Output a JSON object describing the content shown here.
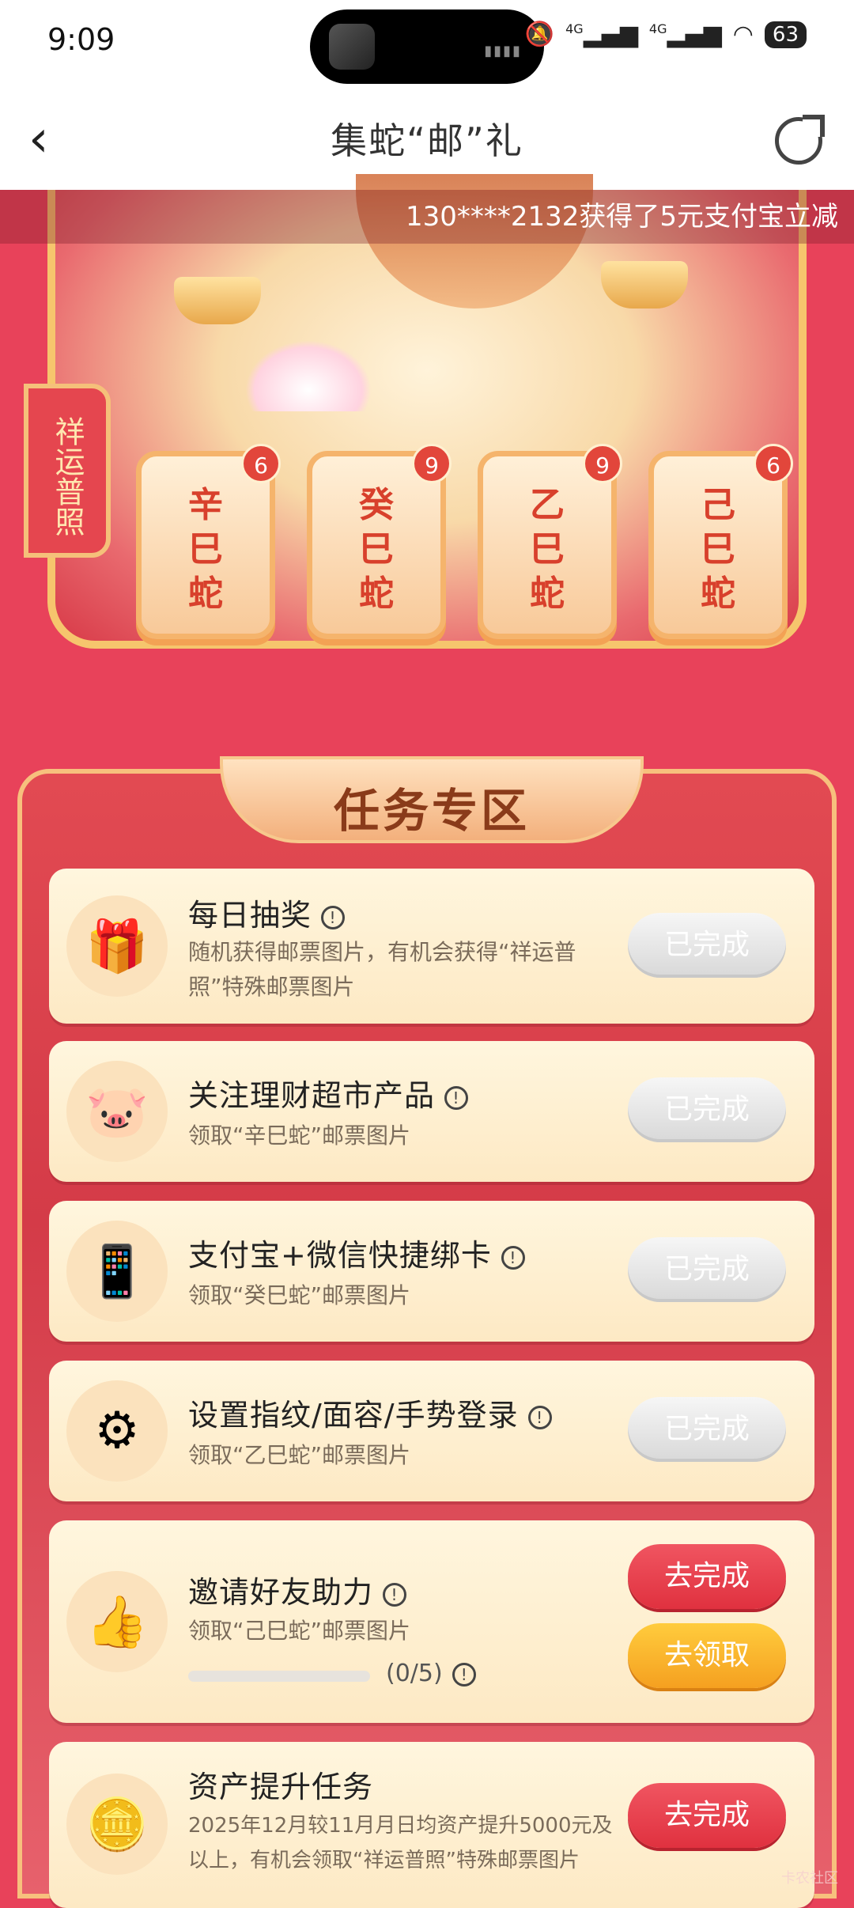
{
  "status_bar": {
    "time": "9:09",
    "signal_1": "4G",
    "signal_2": "4G",
    "battery": "63"
  },
  "nav": {
    "title": "集蛇“邮”礼"
  },
  "ticker": {
    "text": "130****2132获得了5元支付宝立减"
  },
  "stamps": {
    "side_label": "祥运普照",
    "items": [
      {
        "name": "辛巳蛇",
        "line1": "辛",
        "line2": "巳",
        "line3": "蛇",
        "count": "6"
      },
      {
        "name": "癸巳蛇",
        "line1": "癸",
        "line2": "巳",
        "line3": "蛇",
        "count": "9"
      },
      {
        "name": "乙巳蛇",
        "line1": "乙",
        "line2": "巳",
        "line3": "蛇",
        "count": "9"
      },
      {
        "name": "己巳蛇",
        "line1": "己",
        "line2": "巳",
        "line3": "蛇",
        "count": "6"
      }
    ]
  },
  "panel": {
    "title": "任务专区"
  },
  "tasks": [
    {
      "title": "每日抽奖",
      "desc": "随机获得邮票图片，有机会获得“祥运普照”特殊邮票图片",
      "button": "已完成",
      "icon": "gift-icon"
    },
    {
      "title": "关注理财超市产品",
      "desc": "领取“辛巳蛇”邮票图片",
      "button": "已完成",
      "icon": "piggy-bank-icon"
    },
    {
      "title": "支付宝+微信快捷绑卡",
      "desc": "领取“癸巳蛇”邮票图片",
      "button": "已完成",
      "icon": "phone-card-icon"
    },
    {
      "title": "设置指纹/面容/手势登录",
      "desc": "领取“乙巳蛇”邮票图片",
      "button": "已完成",
      "icon": "gear-icon"
    },
    {
      "title": "邀请好友助力",
      "desc": "领取“己巳蛇”邮票图片",
      "button": "去完成",
      "button2": "去领取",
      "progress_text": "(0/5)",
      "progress": 0,
      "icon": "thumbs-up-icon"
    },
    {
      "title": "资产提升任务",
      "desc": "2025年12月较11月月日均资产提升5000元及以上，有机会领取“祥运普照”特殊邮票图片",
      "button": "去完成",
      "icon": "coins-icon"
    }
  ],
  "watermark": "卡农社区"
}
